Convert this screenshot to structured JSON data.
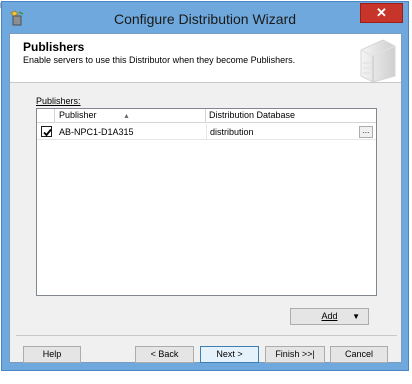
{
  "window": {
    "title": "Configure Distribution Wizard",
    "close_label": "✕"
  },
  "header": {
    "title": "Publishers",
    "subtitle": "Enable servers to use this Distributor when they become Publishers."
  },
  "publishers": {
    "label": "Publishers:",
    "columns": [
      "Publisher",
      "Distribution Database"
    ],
    "rows": [
      {
        "publisher": "AB-NPC1-D1A315",
        "database": "distribution",
        "checked": true,
        "ellipsis": "..."
      }
    ]
  },
  "buttons": {
    "add": "Add",
    "help": "Help",
    "back": "< Back",
    "next": "Next >",
    "finish": "Finish >>|",
    "cancel": "Cancel"
  },
  "background": {
    "fragment": "nt"
  },
  "colors": {
    "title_bar": "#6fa8dc",
    "close": "#c7342a"
  }
}
